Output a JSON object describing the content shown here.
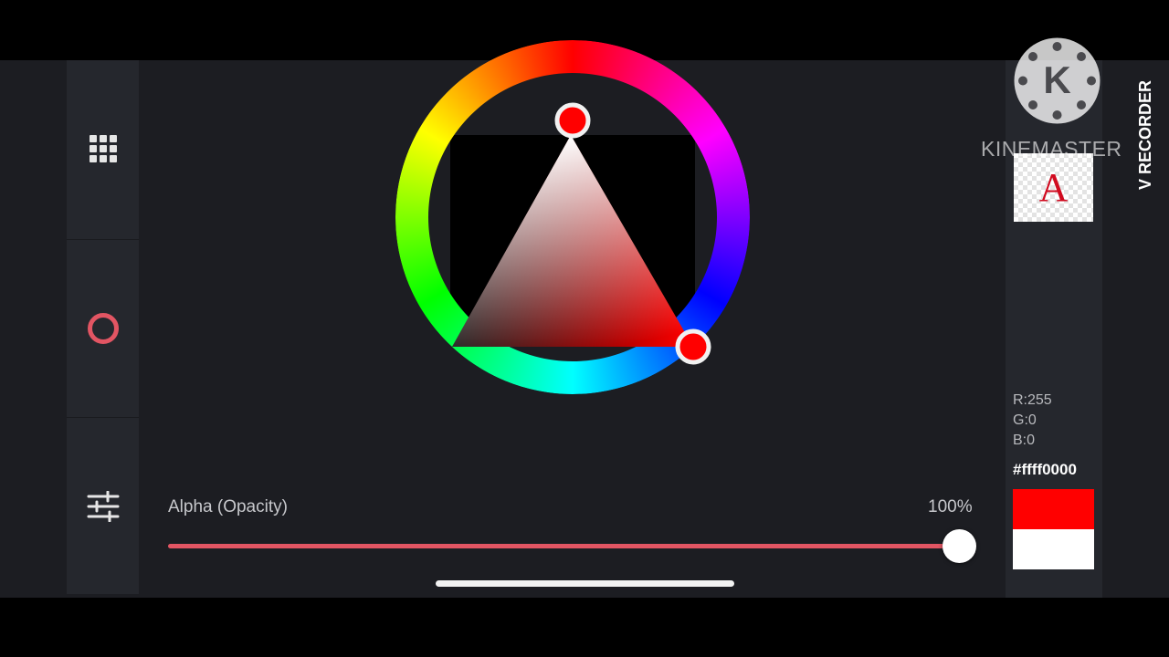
{
  "left_rail": {
    "items": [
      {
        "icon": "grid-icon",
        "active": false
      },
      {
        "icon": "ring-icon",
        "active": true
      },
      {
        "icon": "sliders-icon",
        "active": false
      }
    ]
  },
  "color_picker": {
    "hue": 0,
    "selected_color": "#ff0000"
  },
  "alpha": {
    "label": "Alpha (Opacity)",
    "value_label": "100%",
    "value": 1.0,
    "track_color": "#e25563"
  },
  "rgb": {
    "r": "R:255",
    "g": "G:0",
    "b": "B:0"
  },
  "hex": "#ffff0000",
  "swatches": {
    "new": "#ff0000",
    "previous": "#ffffff"
  },
  "preview": {
    "letter": "A",
    "letter_color": "#d10a1f"
  },
  "watermark": {
    "brand": "KINEMASTER",
    "logo_letter": "K",
    "recorder": "V RECORDER"
  },
  "accent_color": "#e25563"
}
